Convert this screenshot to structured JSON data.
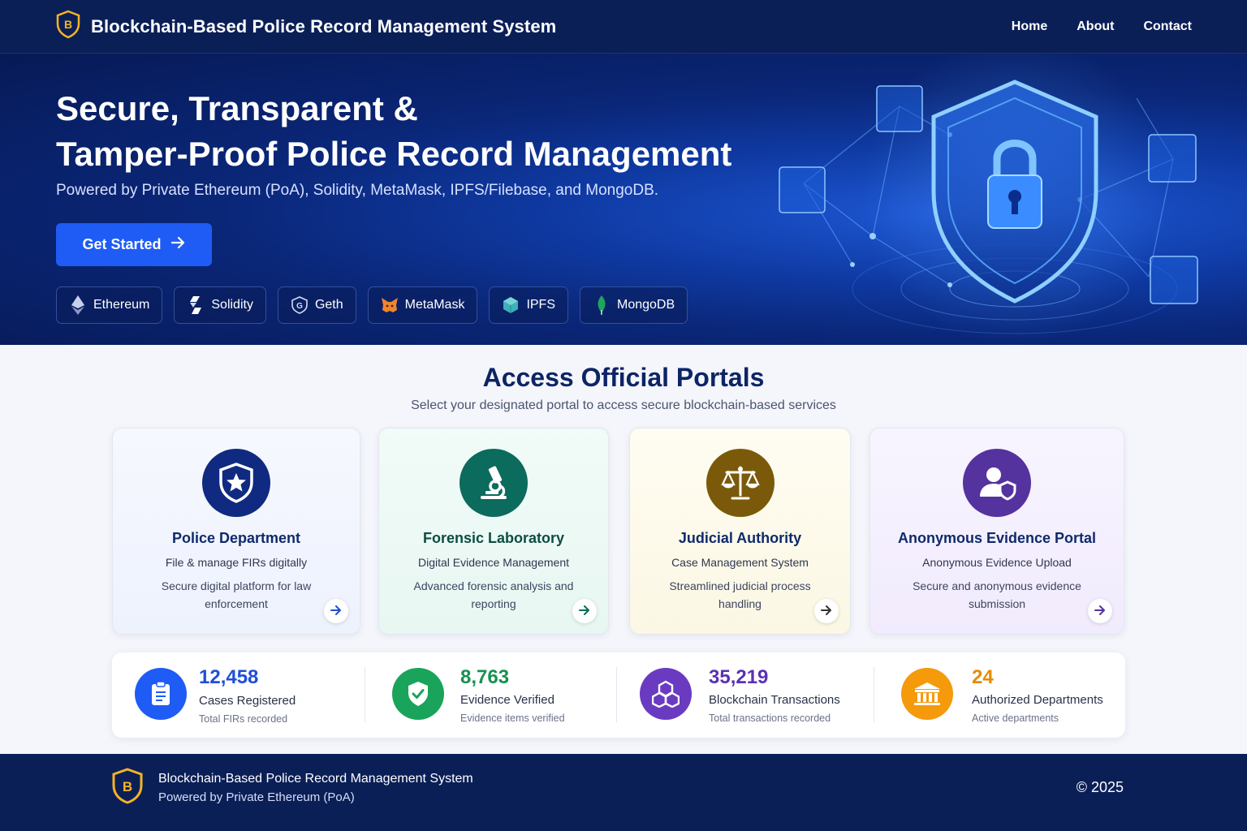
{
  "nav": {
    "title": "Blockchain-Based Police Record Management System",
    "links": [
      "Home",
      "About",
      "Contact"
    ]
  },
  "hero": {
    "title_line1": "Secure, Transparent &",
    "title_line2": "Tamper-Proof Police Record Management",
    "subtitle": "Powered by Private Ethereum (PoA), Solidity, MetaMask, IPFS/Filebase, and MongoDB.",
    "cta_label": "Get Started",
    "tech_chips": [
      {
        "label": "Ethereum",
        "icon": "ethereum-icon"
      },
      {
        "label": "Solidity",
        "icon": "solidity-icon"
      },
      {
        "label": "Geth",
        "icon": "geth-icon"
      },
      {
        "label": "MetaMask",
        "icon": "metamask-icon"
      },
      {
        "label": "IPFS",
        "icon": "ipfs-icon"
      },
      {
        "label": "MongoDB",
        "icon": "mongodb-icon"
      }
    ]
  },
  "portals": {
    "title": "Access Official Portals",
    "subtitle": "Select your designated portal to access secure blockchain-based services",
    "cards": [
      {
        "title": "Police Department",
        "line1": "File & manage FIRs digitally",
        "line2": "Secure digital platform for law enforcement",
        "icon": "police-badge-icon",
        "accent": "#0f2a80"
      },
      {
        "title": "Forensic Laboratory",
        "line1": "Digital Evidence Management",
        "line2": "Advanced forensic analysis and reporting",
        "icon": "microscope-icon",
        "accent": "#0b6b5c"
      },
      {
        "title": "Judicial Authority",
        "line1": "Case Management System",
        "line2": "Streamlined judicial process handling",
        "icon": "scales-icon",
        "accent": "#7a5a0a"
      },
      {
        "title": "Anonymous Evidence Portal",
        "line1": "Anonymous Evidence Upload",
        "line2": "Secure and anonymous evidence submission",
        "icon": "anonymous-user-icon",
        "accent": "#55339e"
      }
    ]
  },
  "stats": [
    {
      "value": "12,458",
      "label": "Cases Registered",
      "desc": "Total FIRs recorded",
      "icon": "clipboard-icon",
      "color": "#1f5cf5"
    },
    {
      "value": "8,763",
      "label": "Evidence Verified",
      "desc": "Evidence items verified",
      "icon": "shield-check-icon",
      "color": "#1aa35a"
    },
    {
      "value": "35,219",
      "label": "Blockchain Transactions",
      "desc": "Total transactions recorded",
      "icon": "blocks-icon",
      "color": "#6a3bc0"
    },
    {
      "value": "24",
      "label": "Authorized Departments",
      "desc": "Active departments",
      "icon": "building-icon",
      "color": "#f59a0b"
    }
  ],
  "footer": {
    "title": "Blockchain-Based Police Record Management System",
    "subtitle": "Powered by Private Ethereum (PoA)",
    "copyright": "© 2025"
  }
}
